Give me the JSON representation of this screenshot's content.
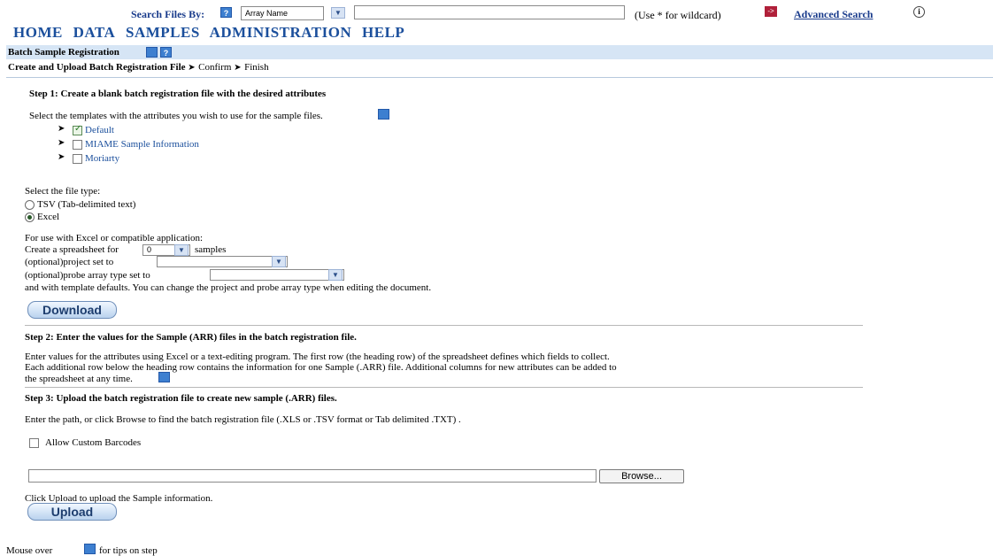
{
  "search": {
    "label": "Search Files By:",
    "field_value": "Array Name",
    "query_value": "",
    "wildcard_hint": "(Use * for wildcard)",
    "go_label": "->",
    "advanced_link": "Advanced Search"
  },
  "nav": {
    "items": [
      "HOME",
      "DATA",
      "SAMPLES",
      "ADMINISTRATION",
      "HELP"
    ]
  },
  "title": "Batch Sample Registration",
  "wizard": {
    "current": "Create and Upload Batch Registration File",
    "steps": [
      "Confirm",
      "Finish"
    ]
  },
  "step1": {
    "heading": "Step 1: Create a blank batch registration file with the desired attributes",
    "templates_prompt": "Select the templates with the attributes you wish to use for the sample files.",
    "templates": [
      {
        "label": "Default",
        "checked": true
      },
      {
        "label": "MIAME Sample Information",
        "checked": false
      },
      {
        "label": "Moriarty",
        "checked": false
      }
    ],
    "filetype_prompt": "Select the file type:",
    "filetypes": [
      {
        "label": "TSV (Tab-delimited text)",
        "selected": false
      },
      {
        "label": "Excel",
        "selected": true
      }
    ],
    "excel_intro": "For use with Excel or compatible application:",
    "spreadsheet_prefix": "Create a spreadsheet for",
    "sample_count": "0",
    "spreadsheet_suffix": "samples",
    "project_label": "(optional)project set to",
    "project_value": "",
    "probe_label": "(optional)probe array type set to",
    "probe_value": "",
    "defaults_note": "and with template defaults. You can change the project and probe array type when editing the document.",
    "download_label": "Download"
  },
  "step2": {
    "heading": "Step 2: Enter the values for the Sample (ARR) files in the batch registration file.",
    "line1": "Enter values for the attributes using Excel or a text-editing program. The first row (the heading row) of the spreadsheet defines which fields to collect.",
    "line2": "Each additional row below the heading row contains the information for one Sample (.ARR) file. Additional columns for new attributes can be added to",
    "line3": "the spreadsheet at any time."
  },
  "step3": {
    "heading": "Step 3: Upload the batch registration file to create new sample (.ARR) files.",
    "path_prompt": "Enter the path, or click Browse to find the batch registration file (.XLS or .TSV format or Tab delimited .TXT) .",
    "custom_barcodes_label": "Allow Custom Barcodes",
    "custom_barcodes_checked": false,
    "file_path": "",
    "browse_label": "Browse...",
    "upload_prompt": "Click Upload to upload the Sample information.",
    "upload_label": "Upload"
  },
  "footer": {
    "prefix": "Mouse over",
    "suffix": "for tips on step"
  },
  "icons": {
    "help": "help-icon",
    "info": "info-icon",
    "dropdown": "chevron-down-icon",
    "expand": "chevron-right-icon",
    "about": "about-icon"
  },
  "colors": {
    "link": "#1a3c8c",
    "nav": "#1b4f9c",
    "band": "#d6e5f5",
    "go": "#b0203a",
    "icon": "#3d7fd0"
  }
}
